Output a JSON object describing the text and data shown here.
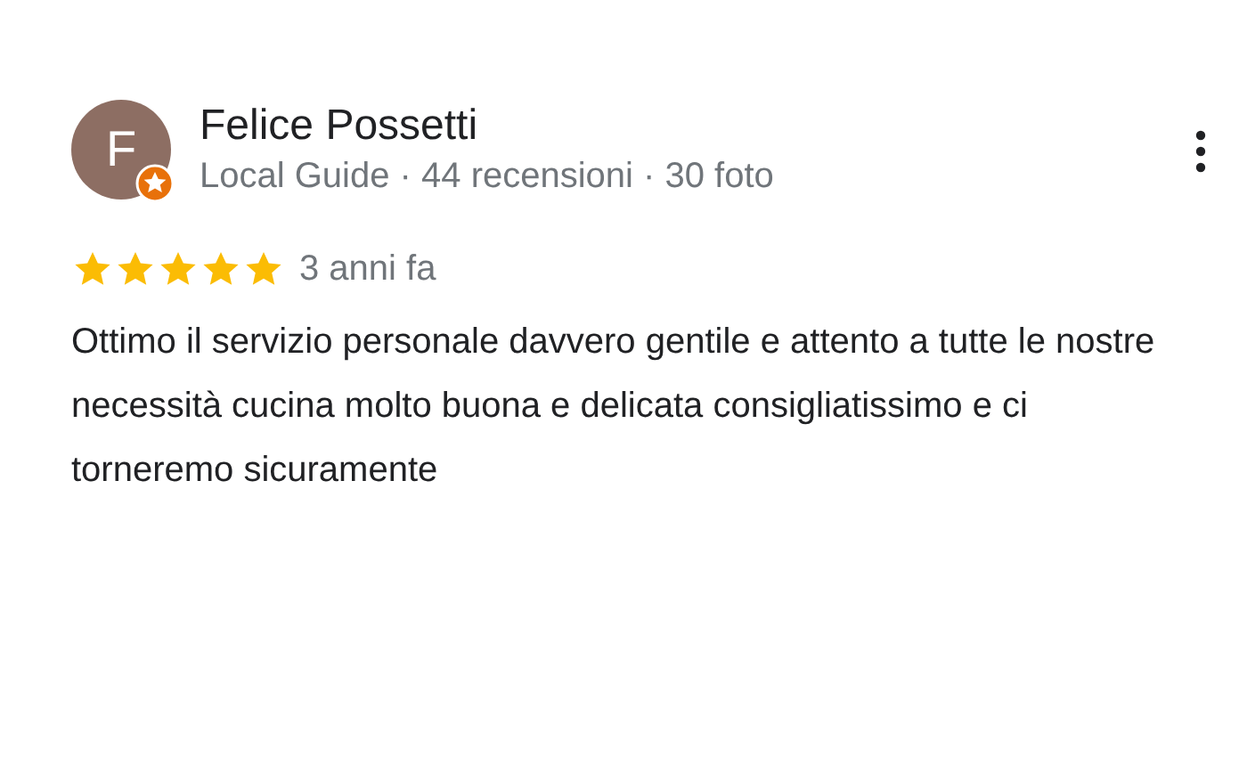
{
  "review": {
    "avatar_letter": "F",
    "author": "Felice Possetti",
    "author_meta": "Local Guide · 44 recensioni · 30 foto",
    "stars": 5,
    "time": "3 anni fa",
    "text": "Ottimo il servizio personale davvero gentile e attento a tutte le nostre necessità cucina molto buona e delicata consigliatissimo e ci torneremo sicuramente"
  }
}
